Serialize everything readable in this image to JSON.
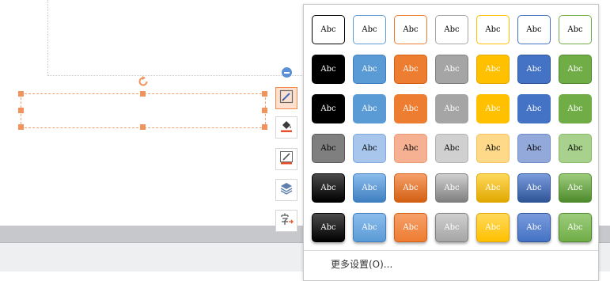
{
  "toolbar": {
    "collapse_icon": "minus-circle-icon",
    "tools": [
      {
        "name": "shape-style-tool",
        "icon": "pen-box-icon",
        "active": true
      },
      {
        "name": "fill-tool",
        "icon": "paint-bucket-icon",
        "active": false
      },
      {
        "name": "outline-tool",
        "icon": "pen-line-icon",
        "active": false
      },
      {
        "name": "layers-tool",
        "icon": "layers-icon",
        "active": false
      },
      {
        "name": "text-tool",
        "icon": "character-icon",
        "active": false
      }
    ]
  },
  "styles_popup": {
    "cell_label": "Abc",
    "rows": [
      [
        "outline-black",
        "outline-blue",
        "outline-orange",
        "outline-gray",
        "outline-gold",
        "outline-navy",
        "outline-green"
      ],
      [
        "fill-black",
        "fill-blue",
        "fill-orange",
        "fill-gray",
        "fill-gold",
        "fill-navy",
        "fill-green"
      ],
      [
        "flat-black",
        "flat-blue",
        "flat-orange",
        "flat-gray",
        "flat-gold",
        "flat-navy",
        "flat-green"
      ],
      [
        "light-black",
        "light-blue",
        "light-orange",
        "light-gray",
        "light-gold",
        "light-navy",
        "light-green"
      ],
      [
        "gradient-black",
        "gradient-blue",
        "gradient-orange",
        "gradient-gray",
        "gradient-gold",
        "gradient-navy",
        "gradient-green"
      ],
      [
        "shadow-black",
        "shadow-blue",
        "shadow-orange",
        "shadow-gray",
        "shadow-gold",
        "shadow-navy",
        "shadow-green"
      ]
    ],
    "more_settings": "更多设置(O)..."
  },
  "colors": {
    "black": "#000000",
    "blue": "#5b9bd5",
    "orange": "#ed7d31",
    "gray": "#a5a5a5",
    "gold": "#ffc000",
    "navy": "#4472c4",
    "green": "#70ad47",
    "selection": "#f0935c"
  }
}
